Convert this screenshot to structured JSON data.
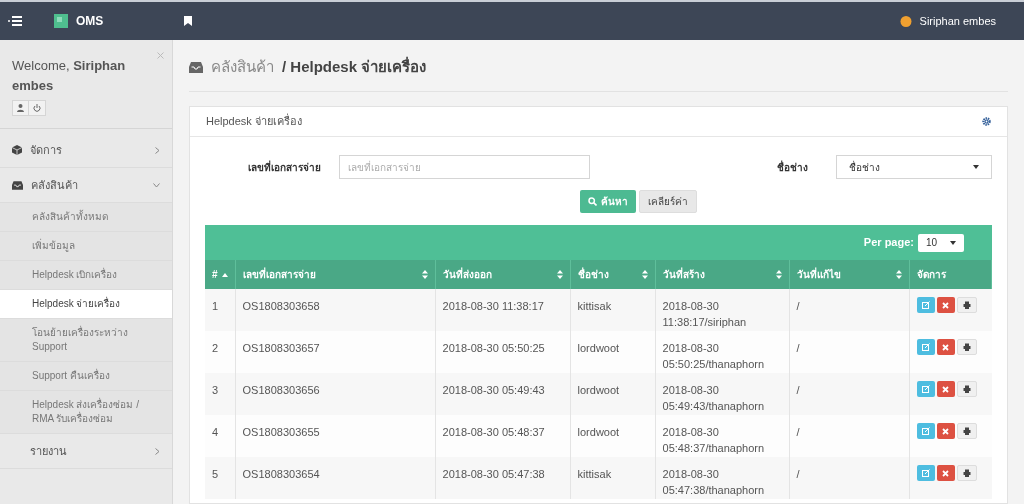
{
  "topbar": {
    "brand": "OMS",
    "user": "Siriphan embes"
  },
  "sidebar": {
    "welcome": "Welcome, **Siriphan embes**",
    "items": [
      {
        "label": "จัดการ",
        "expanded": false
      },
      {
        "label": "คลังสินค้า",
        "expanded": true,
        "children": [
          {
            "label": "คลังสินค้าทั้งหมด",
            "selected": false
          },
          {
            "label": "เพิ่มข้อมูล",
            "selected": false
          },
          {
            "label": "Helpdesk เบิกเครื่อง",
            "selected": false
          },
          {
            "label": "Helpdesk จ่ายเครื่อง",
            "selected": true
          },
          {
            "label": "โอนย้ายเครื่องระหว่าง Support",
            "selected": false
          },
          {
            "label": "Support คืนเครื่อง",
            "selected": false
          },
          {
            "label": "Helpdesk ส่งเครื่องซ่อม / RMA รับเครื่องซ่อม",
            "selected": false
          }
        ]
      },
      {
        "label": "รายงาน",
        "expanded": false
      }
    ]
  },
  "breadcrumb": {
    "parent": "คลังสินค้า",
    "current": "/ Helpdesk จ่ายเครื่อง"
  },
  "panel": {
    "title": "Helpdesk จ่ายเครื่อง",
    "filters": [
      {
        "kind": "text",
        "label": "เลขที่เอกสารจ่าย",
        "placeholder": "เลขที่เอกสารจ่าย"
      },
      {
        "kind": "select",
        "label": "ชื่อช่าง",
        "value": "ชื่อช่าง"
      }
    ],
    "search_button": "ค้นหา",
    "clear_button": "เคลียร์ค่า"
  },
  "table": {
    "per_page_label": "Per page:",
    "per_page": "10",
    "columns": [
      {
        "label": "#",
        "kind": "sorted_asc"
      },
      {
        "label": "เลขที่เอกสารจ่าย",
        "kind": "sortable"
      },
      {
        "label": "วันที่ส่งออก",
        "kind": "sortable"
      },
      {
        "label": "ชื่อช่าง",
        "kind": "sortable"
      },
      {
        "label": "วันที่สร้าง",
        "kind": "sortable"
      },
      {
        "label": "วันที่แก้ไข",
        "kind": "sortable"
      },
      {
        "label": "จัดการ",
        "kind": "plain"
      }
    ],
    "rows": [
      [
        "1",
        "OS1808303658",
        "2018-08-30 11:38:17",
        "kittisak",
        "2018-08-30 11:38:17/siriphan",
        "/"
      ],
      [
        "2",
        "OS1808303657",
        "2018-08-30 05:50:25",
        "lordwoot",
        "2018-08-30 05:50:25/thanaphorn",
        "/"
      ],
      [
        "3",
        "OS1808303656",
        "2018-08-30 05:49:43",
        "lordwoot",
        "2018-08-30 05:49:43/thanaphorn",
        "/"
      ],
      [
        "4",
        "OS1808303655",
        "2018-08-30 05:48:37",
        "lordwoot",
        "2018-08-30 05:48:37/thanaphorn",
        "/"
      ],
      [
        "5",
        "OS1808303654",
        "2018-08-30 05:47:38",
        "kittisak",
        "2018-08-30 05:47:38/thanaphorn",
        "/"
      ]
    ]
  }
}
